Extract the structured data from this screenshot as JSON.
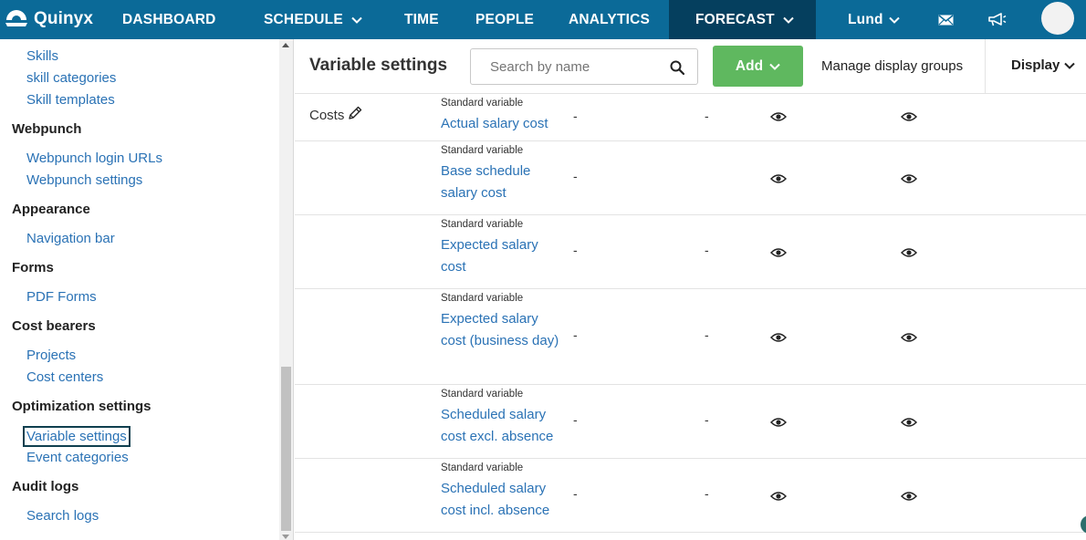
{
  "nav": {
    "brand": "Quinyx",
    "items": [
      "DASHBOARD",
      "SCHEDULE",
      "TIME",
      "PEOPLE",
      "ANALYTICS",
      "FORECAST"
    ],
    "active": "FORECAST",
    "location": "Lund",
    "icons": [
      "mail-icon",
      "megaphone-icon",
      "avatar"
    ]
  },
  "sidebar": {
    "links_top": [
      "Skills",
      "skill categories",
      "Skill templates"
    ],
    "sections": [
      {
        "heading": "Webpunch",
        "links": [
          "Webpunch login URLs",
          "Webpunch settings"
        ]
      },
      {
        "heading": "Appearance",
        "links": [
          "Navigation bar"
        ]
      },
      {
        "heading": "Forms",
        "links": [
          "PDF Forms"
        ]
      },
      {
        "heading": "Cost bearers",
        "links": [
          "Projects",
          "Cost centers"
        ]
      },
      {
        "heading": "Optimization settings",
        "links": [
          "Variable settings",
          "Event categories"
        ]
      },
      {
        "heading": "Audit logs",
        "links": [
          "Search logs"
        ]
      }
    ],
    "selected": "Variable settings"
  },
  "toolbar": {
    "title": "Variable settings",
    "search_placeholder": "Search by name",
    "add_label": "Add",
    "manage_label": "Manage display groups",
    "display_label": "Display"
  },
  "table": {
    "group": "Costs",
    "rows": [
      {
        "type": "Standard variable",
        "name": "Actual salary cost",
        "col1": "-",
        "col2": "-"
      },
      {
        "type": "Standard variable",
        "name": "Base schedule salary cost",
        "col1": "-",
        "col2": "-"
      },
      {
        "type": "Standard variable",
        "name": "Expected salary cost",
        "col1": "-",
        "col2": "-"
      },
      {
        "type": "Standard variable",
        "name": "Expected salary cost (business day)",
        "col1": "-",
        "col2": "-"
      },
      {
        "type": "Standard variable",
        "name": "Scheduled salary cost excl. absence",
        "col1": "-",
        "col2": "-"
      },
      {
        "type": "Standard variable",
        "name": "Scheduled salary cost incl. absence",
        "col1": "-",
        "col2": "-"
      }
    ]
  },
  "colors": {
    "nav_bg": "#0b6a98",
    "nav_active_bg": "#053f5e",
    "link": "#2a72b5",
    "add_button": "#5fb85f"
  }
}
